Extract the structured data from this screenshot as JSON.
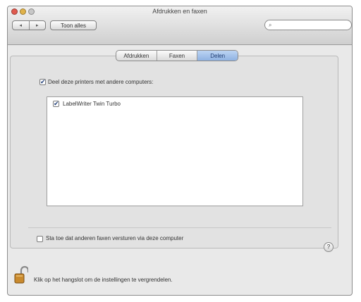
{
  "window": {
    "title": "Afdrukken en faxen"
  },
  "toolbar": {
    "back_glyph": "◂",
    "forward_glyph": "▸",
    "show_all_label": "Toon alles",
    "search_placeholder": ""
  },
  "tabs": [
    {
      "label": "Afdrukken",
      "active": false
    },
    {
      "label": "Faxen",
      "active": false
    },
    {
      "label": "Delen",
      "active": true
    }
  ],
  "sharing": {
    "share_label": "Deel deze printers met andere computers:",
    "share_checked": true,
    "printers": [
      {
        "name": "LabelWriter Twin Turbo",
        "checked": true
      }
    ],
    "fax_label": "Sta toe dat anderen faxen versturen via deze computer",
    "fax_checked": false
  },
  "help": {
    "glyph": "?"
  },
  "lock": {
    "text": "Klik op het hangslot om de instellingen te vergrendelen."
  },
  "icons": {
    "checkmark": "✔",
    "search": "⌕"
  },
  "colors": {
    "accent": "#8fb2e2",
    "window_bg": "#e9e9e9"
  }
}
